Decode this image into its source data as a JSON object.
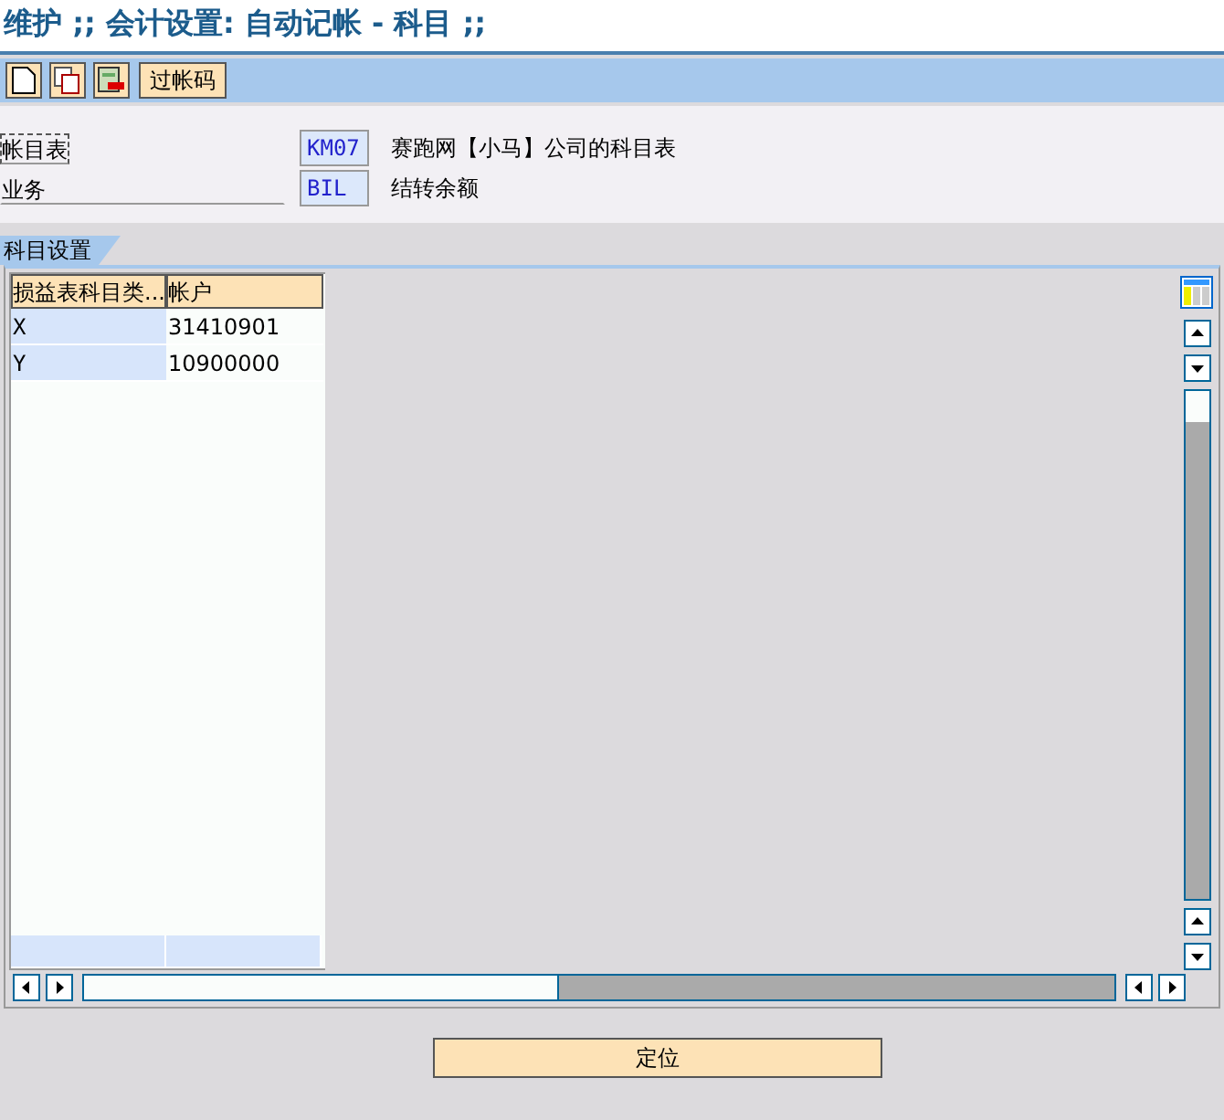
{
  "window": {
    "title": "维护 ;; 会计设置: 自动记帐 - 科目 ;;"
  },
  "toolbar": {
    "buttons": [
      {
        "kind": "new"
      },
      {
        "kind": "copy"
      },
      {
        "kind": "delete"
      },
      {
        "kind": "text",
        "label": "过帐码"
      }
    ]
  },
  "fields": [
    {
      "label": "帐目表",
      "value": "KM07",
      "description": "赛跑网【小马】公司的科目表",
      "focused": true
    },
    {
      "label": "业务",
      "value": "BIL",
      "description": "结转余额",
      "focused": false
    }
  ],
  "tabs": [
    {
      "label": "科目设置",
      "selected": true
    }
  ],
  "table": {
    "columns": [
      "损益表科目类...",
      "帐户"
    ],
    "rows": [
      {
        "cells": [
          "X",
          "31410901"
        ]
      },
      {
        "cells": [
          "Y",
          "10900000"
        ]
      }
    ]
  },
  "buttons": [
    "定位"
  ]
}
